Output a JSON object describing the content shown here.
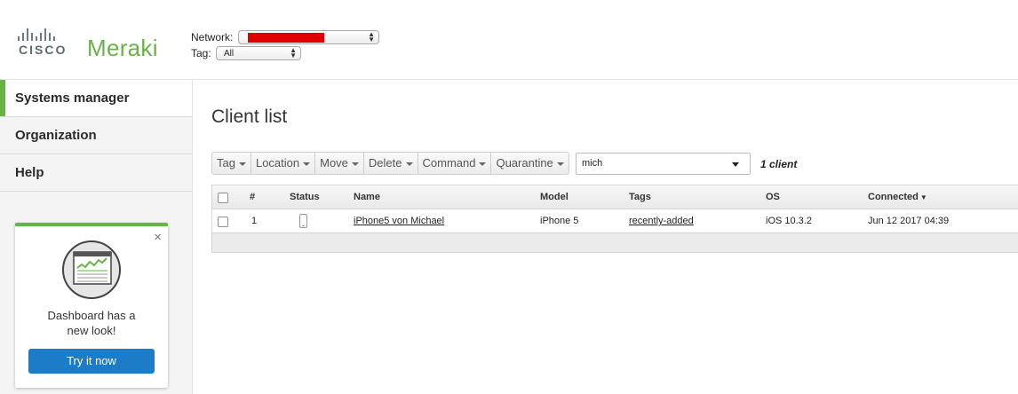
{
  "header": {
    "brand_cisco": "CISCO",
    "brand_meraki": "Meraki",
    "network_label": "Network:",
    "network_value": "",
    "tag_label": "Tag:",
    "tag_value": "All"
  },
  "sidebar": {
    "items": [
      {
        "label": "Systems manager",
        "active": true
      },
      {
        "label": "Organization",
        "active": false
      },
      {
        "label": "Help",
        "active": false
      }
    ],
    "promo": {
      "text_line1": "Dashboard has a",
      "text_line2": "new look!",
      "button_label": "Try it now",
      "close_glyph": "×"
    }
  },
  "main": {
    "title": "Client list",
    "toolbar": [
      "Tag",
      "Location",
      "Move",
      "Delete",
      "Command",
      "Quarantine"
    ],
    "search_value": "mich",
    "client_count": "1 client",
    "table": {
      "columns": [
        "#",
        "Status",
        "Name",
        "Model",
        "Tags",
        "OS",
        "Connected"
      ],
      "sort_indicator": "▼",
      "rows": [
        {
          "num": "1",
          "status": "phone-icon",
          "name": "iPhone5 von Michael",
          "model": "iPhone 5",
          "tags": "recently-added",
          "os": "iOS 10.3.2",
          "connected": "Jun 12 2017 04:39"
        }
      ]
    }
  },
  "colors": {
    "brand_green": "#67b346",
    "button_blue": "#1c7cc7",
    "link_green": "#1a7a1a"
  }
}
